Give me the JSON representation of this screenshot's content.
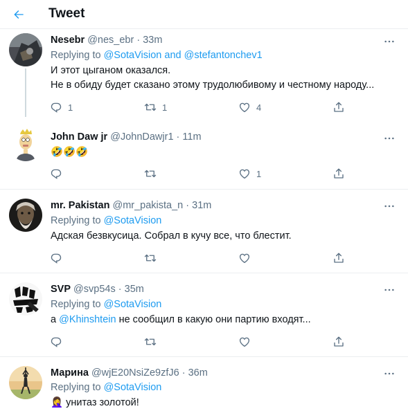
{
  "header": {
    "title": "Tweet"
  },
  "tweets": [
    {
      "name": "Nesebr",
      "handle": "@nes_ebr",
      "sep": "·",
      "time": "33m",
      "replying_prefix": "Replying to",
      "replying_to": "@SotaVision and @stefantonchev1",
      "lines": [
        "И этот цыганом оказался.",
        "Не в обиду будет сказано этому трудолюбивому и честному народу..."
      ],
      "counts": {
        "reply": "1",
        "retweet": "1",
        "like": "4"
      }
    },
    {
      "name": "John Daw jr",
      "handle": "@JohnDawjr1",
      "sep": "·",
      "time": "11m",
      "text": "🤣🤣🤣",
      "counts": {
        "reply": "",
        "retweet": "",
        "like": "1"
      }
    },
    {
      "name": "mr. Pakistan",
      "handle": "@mr_pakista_n",
      "sep": "·",
      "time": "31m",
      "replying_prefix": "Replying to",
      "replying_to": "@SotaVision",
      "text": "Адская безвкусица. Собрал в кучу все, что блестит.",
      "counts": {
        "reply": "",
        "retweet": "",
        "like": ""
      }
    },
    {
      "name": "SVP",
      "handle": "@svp54s",
      "sep": "·",
      "time": "35m",
      "replying_prefix": "Replying to",
      "replying_to": "@SotaVision",
      "text_prefix": "а",
      "text_mention": "@Khinshtein",
      "text_rest": "не сообщил в какую они партию входят...",
      "counts": {
        "reply": "",
        "retweet": "",
        "like": ""
      }
    },
    {
      "name": "Марина",
      "handle": "@wjE20NsiZe9zfJ6",
      "sep": "·",
      "time": "36m",
      "replying_prefix": "Replying to",
      "replying_to": "@SotaVision",
      "text": "🤦‍♀️ унитаз золотой!"
    }
  ],
  "colors": {
    "accent": "#1d9bf0",
    "secondary_text": "#5b7083",
    "divider": "#ebeef0"
  },
  "icons": [
    "back-arrow-icon",
    "more-icon",
    "reply-icon",
    "retweet-icon",
    "like-icon",
    "share-icon"
  ]
}
